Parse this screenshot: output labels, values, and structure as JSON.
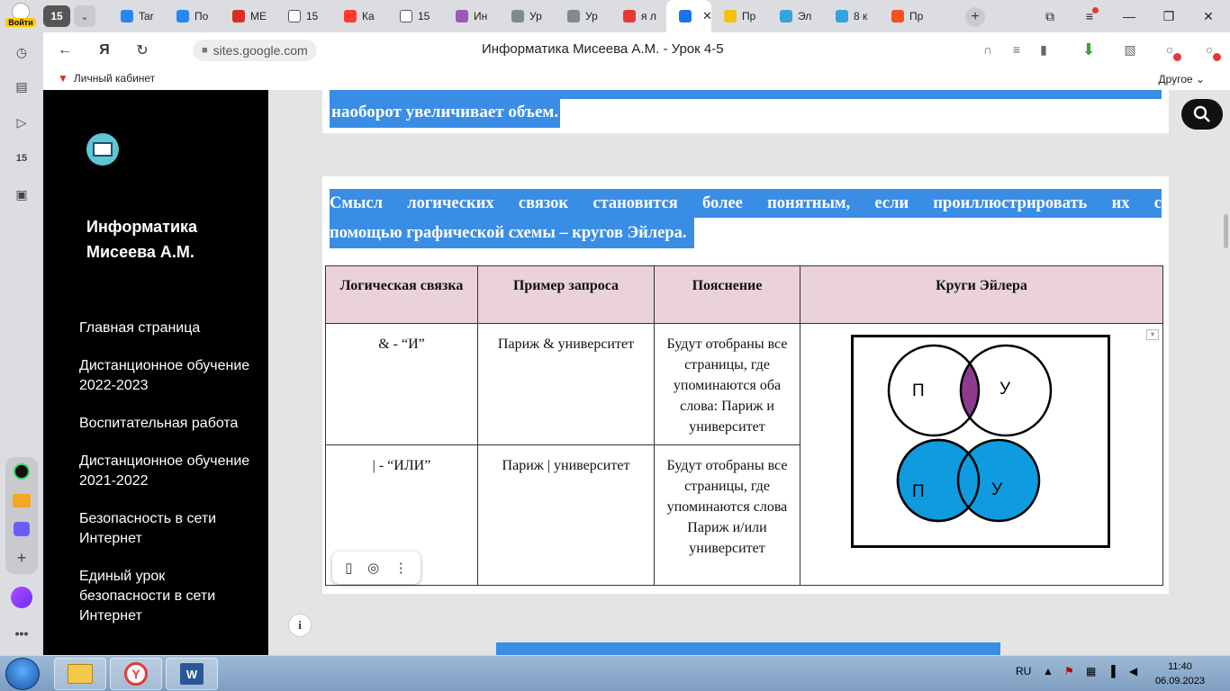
{
  "browser": {
    "login_label": "Войти",
    "tab_count": "15",
    "tabs": [
      {
        "label": "Tar",
        "color": "#2787f5",
        "icon": "vk-icon"
      },
      {
        "label": "По",
        "color": "#2787f5",
        "icon": "mail-icon"
      },
      {
        "label": "МЕ",
        "color": "#d93025",
        "icon": "book-icon"
      },
      {
        "label": "15",
        "color": "#ffffff",
        "icon": "doc-icon"
      },
      {
        "label": "Ка",
        "color": "#ff3b30",
        "icon": "youtube-icon"
      },
      {
        "label": "15",
        "color": "#ffffff",
        "icon": "doc-icon"
      },
      {
        "label": "Ин",
        "color": "#9b59b6",
        "icon": "grid-icon"
      },
      {
        "label": "Ур",
        "color": "#7f8c8d",
        "icon": "copy-icon"
      },
      {
        "label": "Ур",
        "color": "#7f8c8d",
        "icon": "copy-icon"
      },
      {
        "label": "я л",
        "color": "#e53935",
        "icon": "yandex-icon"
      },
      {
        "label": "",
        "color": "#1a73e8",
        "icon": "sites-icon",
        "active": true
      },
      {
        "label": "Пр",
        "color": "#f4c20d",
        "icon": "info-icon"
      },
      {
        "label": "Эл",
        "color": "#34a3de",
        "icon": "flask-icon"
      },
      {
        "label": "8 к",
        "color": "#34a3de",
        "icon": "flask-icon"
      },
      {
        "label": "Пр",
        "color": "#f4511e",
        "icon": "shield-icon"
      }
    ],
    "url": "sites.google.com",
    "page_title": "Информатика Мисеева А.М. - Урок 4-5",
    "bookmark_personal": "Личный кабинет",
    "bookmark_other": "Другое"
  },
  "site": {
    "title_line1": "Информатика",
    "title_line2": "Мисеева А.М.",
    "nav": [
      "Главная страница",
      "Дистанционное обучение 2022-2023",
      "Воспитательная работа",
      "Дистанционное обучение 2021-2022",
      "Безопасность в сети Интернет",
      "Единый урок безопасности в сети Интернет"
    ]
  },
  "content": {
    "top_text": "наоборот увеличивает объем.",
    "intro_line1": "Смысл логических связок становится более понятным, если проиллюстрировать их с",
    "intro_line2": "помощью графической схемы – кругов Эйлера.",
    "table": {
      "headers": [
        "Логическая связка",
        "Пример запроса",
        "Пояснение",
        "Круги Эйлера"
      ],
      "rows": [
        {
          "op": "& - “И”",
          "example": "Париж & университет",
          "explain": "Будут отобраны все страницы, где упоминаются оба слова: Париж и университет"
        },
        {
          "op": "| - “ИЛИ”",
          "example": "Париж | университет",
          "explain": "Будут отобраны все страницы, где упоминаются слова Париж и/или университет"
        }
      ],
      "euler_left": "П",
      "euler_right": "У",
      "and_fill": "#8e3a8f",
      "or_fill": "#0e9be0"
    }
  },
  "taskbar": {
    "lang": "RU",
    "time": "11:40",
    "date": "06.09.2023"
  }
}
